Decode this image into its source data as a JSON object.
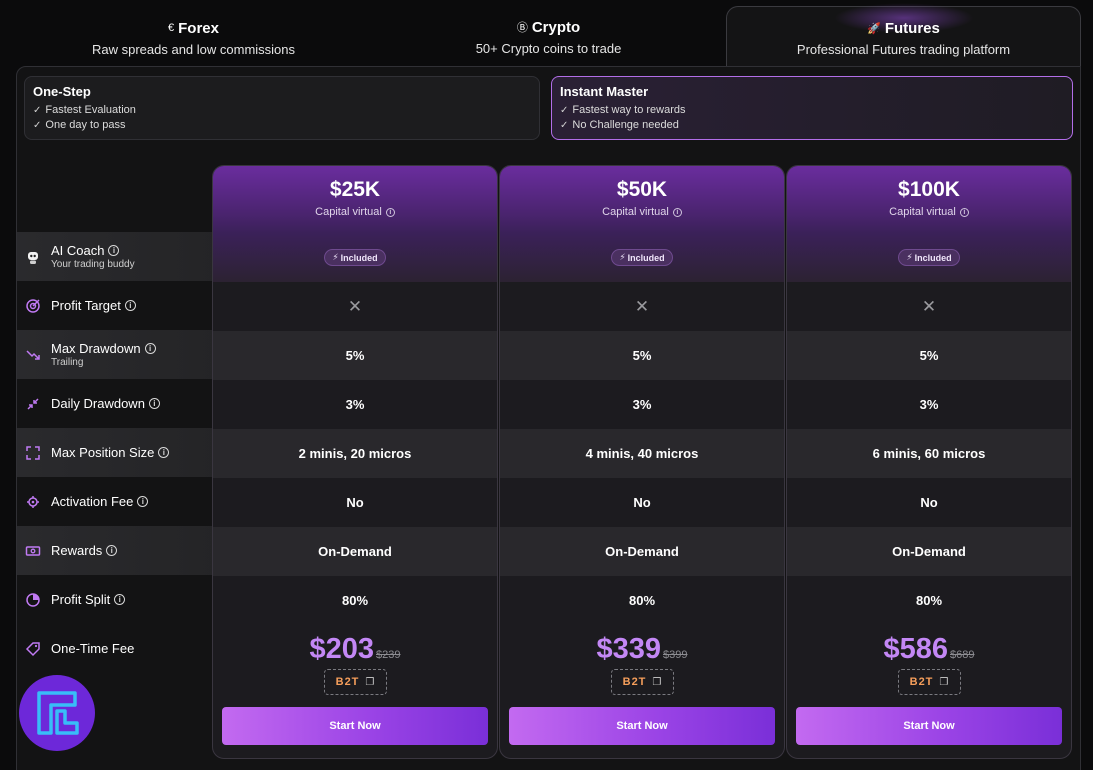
{
  "tabs": [
    {
      "icon": "€",
      "label": "Forex",
      "sub": "Raw spreads and low commissions",
      "active": false
    },
    {
      "icon": "Ⓑ",
      "label": "Crypto",
      "sub": "50+ Crypto coins to trade",
      "active": false
    },
    {
      "icon": "🚀",
      "label": "Futures",
      "sub": "Professional Futures trading platform",
      "active": true
    }
  ],
  "challenge_types": [
    {
      "title": "One-Step",
      "features": [
        "Fastest Evaluation",
        "One day to pass"
      ],
      "selected": false
    },
    {
      "title": "Instant Master",
      "features": [
        "Fastest way to rewards",
        "No Challenge needed"
      ],
      "selected": true
    }
  ],
  "rows": [
    {
      "key": "ai_coach",
      "icon": "robot-icon",
      "label": "AI Coach",
      "sub": "Your trading buddy"
    },
    {
      "key": "profit_target",
      "icon": "target-icon",
      "label": "Profit Target",
      "sub": ""
    },
    {
      "key": "max_drawdown",
      "icon": "trend-down-icon",
      "label": "Max Drawdown",
      "sub": "Trailing"
    },
    {
      "key": "daily_drawdown",
      "icon": "compress-icon",
      "label": "Daily Drawdown",
      "sub": ""
    },
    {
      "key": "max_position",
      "icon": "expand-icon",
      "label": "Max Position Size",
      "sub": ""
    },
    {
      "key": "activation_fee",
      "icon": "gear-icon",
      "label": "Activation Fee",
      "sub": ""
    },
    {
      "key": "rewards",
      "icon": "cash-icon",
      "label": "Rewards",
      "sub": ""
    },
    {
      "key": "profit_split",
      "icon": "pie-icon",
      "label": "Profit Split",
      "sub": ""
    },
    {
      "key": "one_time_fee",
      "icon": "tag-icon",
      "label": "One-Time Fee",
      "sub": ""
    }
  ],
  "plans": [
    {
      "size": "$25K",
      "capital_label": "Capital virtual",
      "ai_coach": "Included",
      "profit_target": "✕",
      "max_drawdown": "5%",
      "daily_drawdown": "3%",
      "max_position": "2 minis, 20 micros",
      "activation_fee": "No",
      "rewards": "On-Demand",
      "profit_split": "80%",
      "price": "$203",
      "old_price": "$239",
      "code": "B2T",
      "cta": "Start Now"
    },
    {
      "size": "$50K",
      "capital_label": "Capital virtual",
      "ai_coach": "Included",
      "profit_target": "✕",
      "max_drawdown": "5%",
      "daily_drawdown": "3%",
      "max_position": "4 minis, 40 micros",
      "activation_fee": "No",
      "rewards": "On-Demand",
      "profit_split": "80%",
      "price": "$339",
      "old_price": "$399",
      "code": "B2T",
      "cta": "Start Now"
    },
    {
      "size": "$100K",
      "capital_label": "Capital virtual",
      "ai_coach": "Included",
      "profit_target": "✕",
      "max_drawdown": "5%",
      "daily_drawdown": "3%",
      "max_position": "6 minis, 60 micros",
      "activation_fee": "No",
      "rewards": "On-Demand",
      "profit_split": "80%",
      "price": "$586",
      "old_price": "$689",
      "code": "B2T",
      "cta": "Start Now"
    }
  ],
  "colors": {
    "accent": "#a855f7",
    "price": "#c387f5",
    "code": "#f59e5b",
    "background": "#0b0b0c"
  }
}
